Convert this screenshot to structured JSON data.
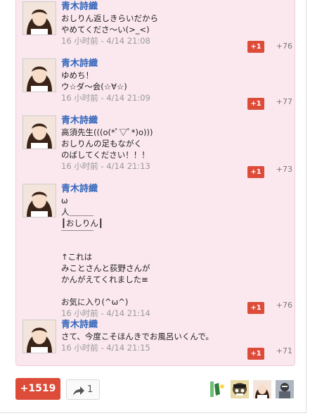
{
  "comments": [
    {
      "author": "青木詩織",
      "lines": [
        "おしりん返しきらいだから",
        "やめてくださ〜い(>_<)"
      ],
      "meta": "16 小时前 - 4/14 21:08",
      "plus_label": "+1",
      "plus_count": "+76"
    },
    {
      "author": "青木詩織",
      "lines": [
        "ゆめち！",
        "ウ☆ダ〜会(☆∀☆)"
      ],
      "meta": "16 小时前 - 4/14 21:09",
      "plus_label": "+1",
      "plus_count": "+77"
    },
    {
      "author": "青木詩織",
      "lines": [
        "高須先生(((o(*ﾟ▽ﾟ*)o)))",
        "おしりんの足もながく",
        "のばしてください！！！"
      ],
      "meta": "16 小时前 - 4/14 21:13",
      "plus_label": "+1",
      "plus_count": "+73"
    },
    {
      "author": "青木詩織",
      "lines": [
        "ω",
        "人＿＿＿",
        "┃おしりん┃",
        "￣￣￣￣",
        "",
        "↑これは",
        "みことさんと荻野さんが",
        "かんがえてくれました≡",
        "",
        "お気に入り(^ω^)"
      ],
      "meta": "16 小时前 - 4/14 21:14",
      "plus_label": "+1",
      "plus_count": "+76"
    },
    {
      "author": "青木詩織",
      "lines": [
        "さて、今度こそほんきでお風呂いくんで。"
      ],
      "meta": "16 小时前 - 4/14 21:15",
      "plus_label": "+1",
      "plus_count": "+71"
    }
  ],
  "footer": {
    "plus_total": "+1519",
    "share_count": "1"
  },
  "colors": {
    "accent": "#dd4b39",
    "author": "#3366bb",
    "panel": "#fbe8ee"
  },
  "icons": [
    "share-arrow-icon"
  ]
}
